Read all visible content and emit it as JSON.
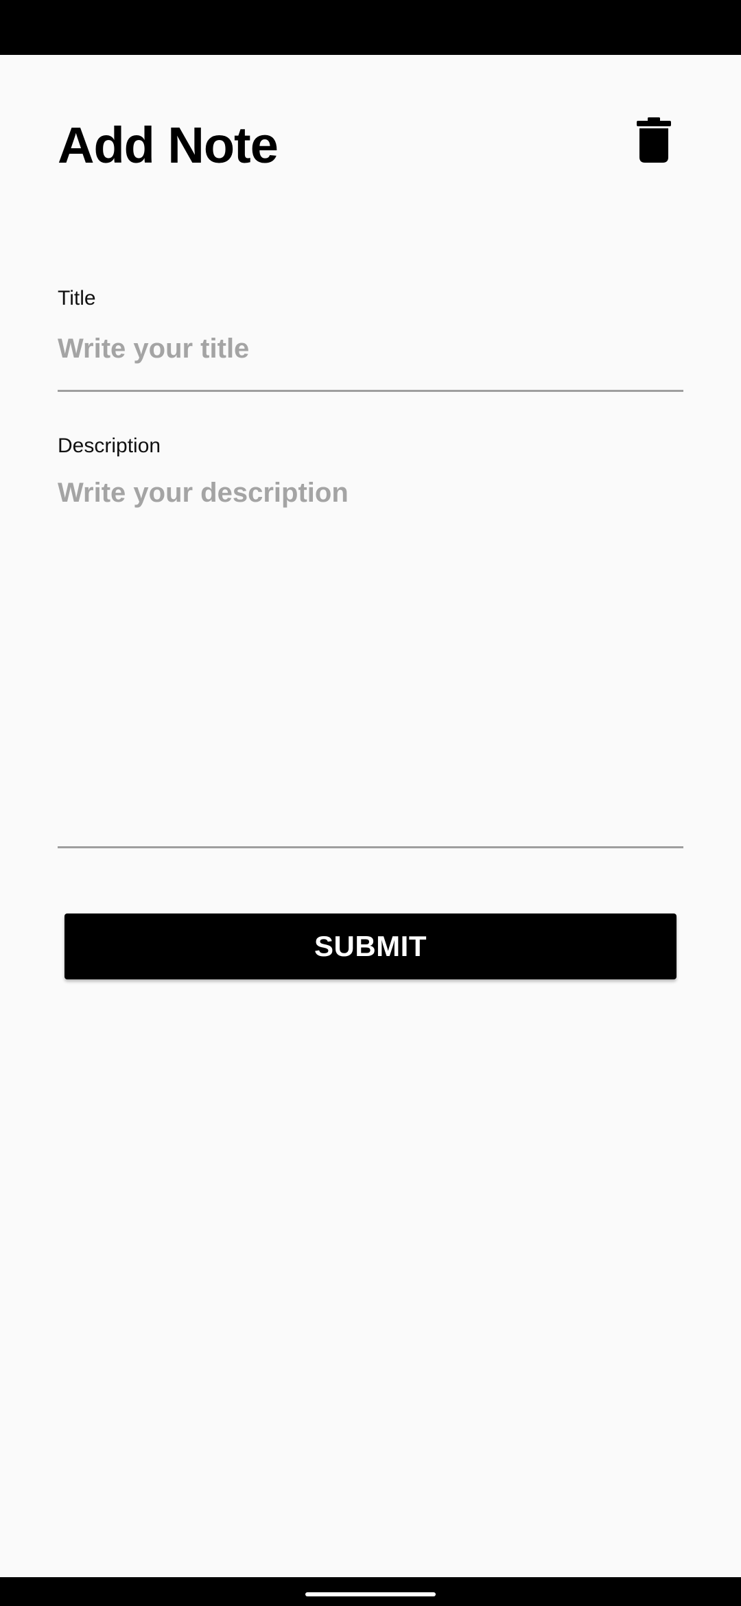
{
  "header": {
    "title": "Add Note",
    "delete_icon": "trash-icon"
  },
  "form": {
    "title_field": {
      "label": "Title",
      "value": "",
      "placeholder": "Write your title"
    },
    "description_field": {
      "label": "Description",
      "value": "",
      "placeholder": "Write your description"
    },
    "submit_label": "SUBMIT"
  },
  "colors": {
    "background": "#fafafa",
    "primary": "#000000",
    "placeholder": "#a4a4a4",
    "underline": "#9e9e9e",
    "button_text": "#ffffff"
  }
}
